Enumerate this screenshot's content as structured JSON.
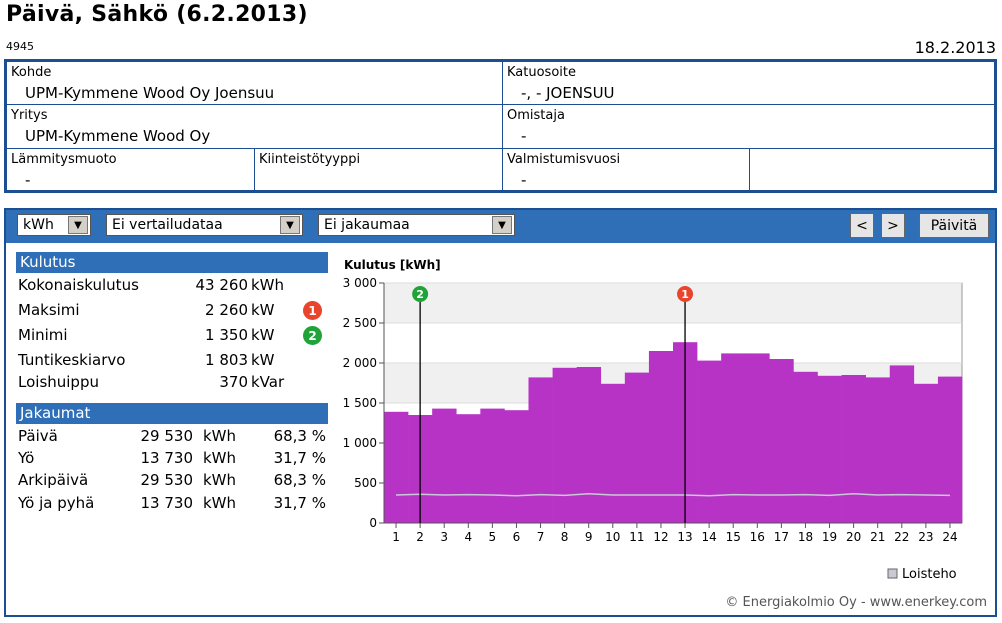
{
  "header": {
    "title": "Päivä, Sähkö (6.2.2013)",
    "code": "4945",
    "date": "18.2.2013"
  },
  "info": {
    "kohde_label": "Kohde",
    "kohde_value": "UPM-Kymmene Wood Oy Joensuu",
    "katuosoite_label": "Katuosoite",
    "katuosoite_value": "-, - JOENSUU",
    "yritys_label": "Yritys",
    "yritys_value": "UPM-Kymmene Wood Oy",
    "omistaja_label": "Omistaja",
    "omistaja_value": "-",
    "lammitysmuoto_label": "Lämmitysmuoto",
    "lammitysmuoto_value": "-",
    "kiinteistotyyppi_label": "Kiinteistötyyppi",
    "kiinteistotyyppi_value": "",
    "valmistumisvuosi_label": "Valmistumisvuosi",
    "valmistumisvuosi_value": "-"
  },
  "toolbar": {
    "unit_select": "kWh",
    "compare_select": "Ei vertailudataa",
    "distribution_select": "Ei jakaumaa",
    "prev_label": "<",
    "next_label": ">",
    "update_label": "Päivitä"
  },
  "kulutus": {
    "heading": "Kulutus",
    "rows": [
      {
        "label": "Kokonaiskulutus",
        "value": "43 260",
        "unit": "kWh",
        "badge": ""
      },
      {
        "label": "Maksimi",
        "value": "2 260",
        "unit": "kW",
        "badge": "1"
      },
      {
        "label": "Minimi",
        "value": "1 350",
        "unit": "kW",
        "badge": "2"
      },
      {
        "label": "Tuntikeskiarvo",
        "value": "1 803",
        "unit": "kW",
        "badge": ""
      },
      {
        "label": "Loishuippu",
        "value": "370",
        "unit": "kVar",
        "badge": ""
      }
    ]
  },
  "jakaumat": {
    "heading": "Jakaumat",
    "rows": [
      {
        "label": "Päivä",
        "value": "29 530",
        "unit": "kWh",
        "pct": "68,3 %"
      },
      {
        "label": "Yö",
        "value": "13 730",
        "unit": "kWh",
        "pct": "31,7 %"
      },
      {
        "label": "Arkipäivä",
        "value": "29 530",
        "unit": "kWh",
        "pct": "68,3 %"
      },
      {
        "label": "Yö ja pyhä",
        "value": "13 730",
        "unit": "kWh",
        "pct": "31,7 %"
      }
    ]
  },
  "colors": {
    "accent": "#2e6fb7",
    "bar": "#b633c6",
    "max_badge": "#e8452c",
    "min_badge": "#22a33a",
    "loisteho": "#c9c9d6"
  },
  "chart_data": {
    "type": "bar",
    "title": "Kulutus [kWh]",
    "categories": [
      "1",
      "2",
      "3",
      "4",
      "5",
      "6",
      "7",
      "8",
      "9",
      "10",
      "11",
      "12",
      "13",
      "14",
      "15",
      "16",
      "17",
      "18",
      "19",
      "20",
      "21",
      "22",
      "23",
      "24"
    ],
    "series": [
      {
        "name": "",
        "values": [
          1390,
          1350,
          1430,
          1360,
          1430,
          1410,
          1820,
          1940,
          1950,
          1740,
          1880,
          2150,
          2260,
          2030,
          2120,
          2120,
          2050,
          1890,
          1840,
          1850,
          1820,
          1970,
          1740,
          1830
        ]
      },
      {
        "name": "Loisteho",
        "values": [
          350,
          360,
          350,
          355,
          350,
          340,
          355,
          345,
          365,
          350,
          350,
          350,
          350,
          340,
          355,
          350,
          350,
          355,
          345,
          365,
          350,
          355,
          350,
          345
        ]
      }
    ],
    "ylim": [
      0,
      3000
    ],
    "yticks": [
      "0",
      "500",
      "1 000",
      "1 500",
      "2 000",
      "2 500",
      "3 000"
    ],
    "markers": [
      {
        "label": "2",
        "hour": 2
      },
      {
        "label": "1",
        "hour": 13
      }
    ],
    "legend": "Loisteho",
    "legend_position": "bottom-right"
  },
  "footer": {
    "copyright": "© Energiakolmio Oy - www.enerkey.com"
  }
}
